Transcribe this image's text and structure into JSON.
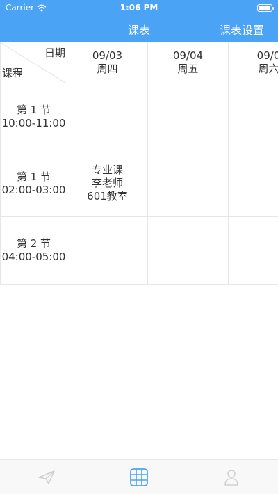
{
  "status_bar": {
    "carrier": "Carrier",
    "time": "1:06 PM"
  },
  "nav": {
    "title": "课表",
    "settings_label": "课表设置"
  },
  "header": {
    "date_label": "日期",
    "course_label": "课程"
  },
  "days": [
    {
      "date": "09/03",
      "weekday": "周四"
    },
    {
      "date": "09/04",
      "weekday": "周五"
    },
    {
      "date": "09/0",
      "weekday": "周六"
    }
  ],
  "periods": [
    {
      "name": "第 1 节",
      "time": "10:00-11:00",
      "cells": [
        "",
        "",
        ""
      ]
    },
    {
      "name": "第 1 节",
      "time": "02:00-03:00",
      "cells": [
        "专业课\n李老师\n601教室",
        "",
        ""
      ]
    },
    {
      "name": "第 2 节",
      "time": "04:00-05:00",
      "cells": [
        "",
        "",
        ""
      ]
    }
  ],
  "tabs": [
    {
      "icon": "send-icon",
      "active": false
    },
    {
      "icon": "grid-icon",
      "active": true
    },
    {
      "icon": "person-icon",
      "active": false
    }
  ],
  "colors": {
    "accent": "#4aa3f5",
    "icon_inactive": "#cfcfcf"
  }
}
